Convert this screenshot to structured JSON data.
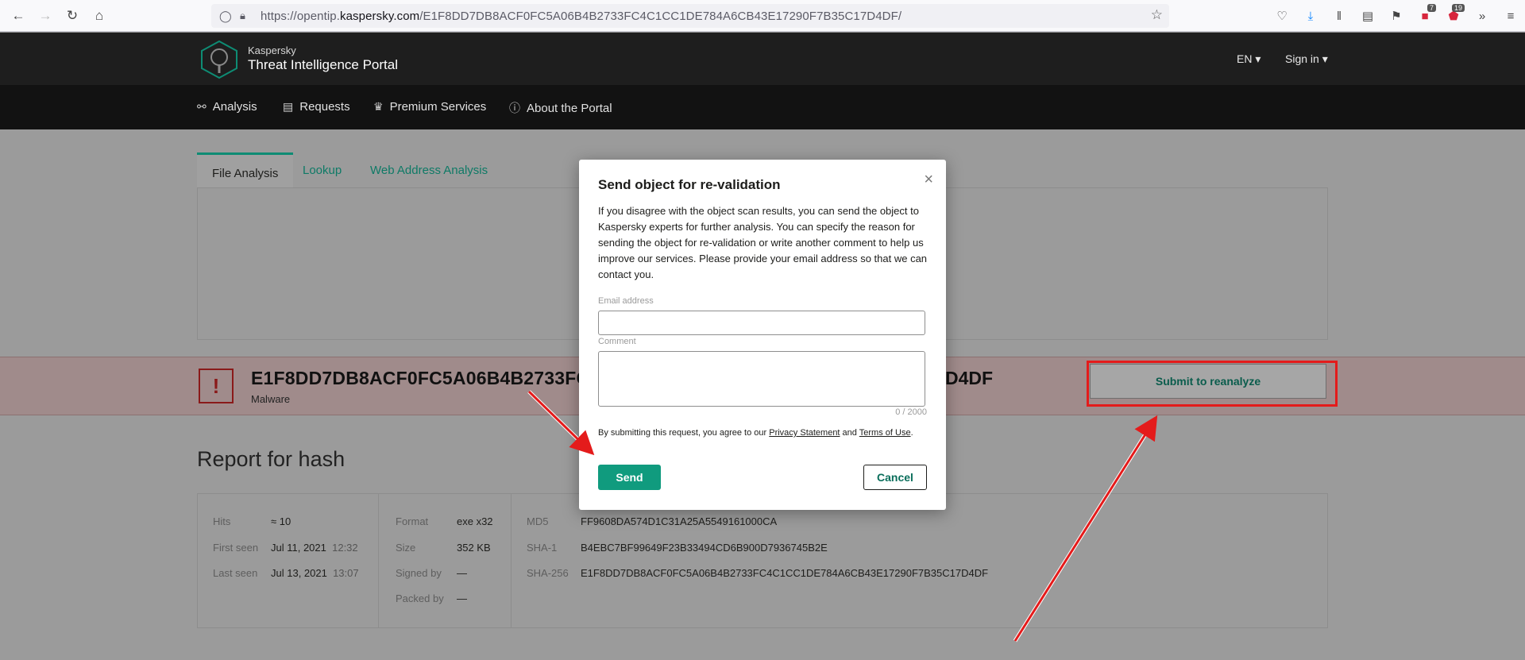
{
  "browser": {
    "url_prefix": "https://opentip.",
    "url_domain": "kaspersky.com",
    "url_path": "/E1F8DD7DB8ACF0FC5A06B4B2733FC4C1CC1DE784A6CB43E17290F7B35C17D4DF/",
    "badge_1": "7",
    "badge_2": "19"
  },
  "site": {
    "brand_small": "Kaspersky",
    "brand_big": "Threat Intelligence Portal",
    "lang": "EN ▾",
    "signin": "Sign in ▾",
    "nav": [
      "Analysis",
      "Requests",
      "Premium Services",
      "About the Portal"
    ]
  },
  "tabs": [
    "File Analysis",
    "Lookup",
    "Web Address Analysis"
  ],
  "alert": {
    "hash_visible": "E1F8DD7DB8ACF0FC5A06B4B2733FC",
    "hash_tail": "D4DF",
    "verdict": "Malware",
    "reanalyze_label": "Submit to reanalyze"
  },
  "report": {
    "title": "Report for hash",
    "hits_label": "Hits",
    "hits_value": "≈ 10",
    "first_seen_label": "First seen",
    "first_seen_date": "Jul 11, 2021",
    "first_seen_time": "12:32",
    "last_seen_label": "Last seen",
    "last_seen_date": "Jul 13, 2021",
    "last_seen_time": "13:07",
    "format_label": "Format",
    "format_value": "exe x32",
    "size_label": "Size",
    "size_value": "352 KB",
    "signed_label": "Signed by",
    "signed_value": "—",
    "packed_label": "Packed by",
    "packed_value": "—",
    "md5_label": "MD5",
    "md5_value": "FF9608DA574D1C31A25A5549161000CA",
    "sha1_label": "SHA-1",
    "sha1_value": "B4EBC7BF99649F23B33494CD6B900D7936745B2E",
    "sha256_label": "SHA-256",
    "sha256_value": "E1F8DD7DB8ACF0FC5A06B4B2733FC4C1CC1DE784A6CB43E17290F7B35C17D4DF"
  },
  "modal": {
    "title": "Send object for re-validation",
    "close": "×",
    "body": "If you disagree with the object scan results, you can send the object to Kaspersky experts for further analysis. You can specify the reason for sending the object for re-validation or write another comment to help us improve our services. Please provide your email address so that we can contact you.",
    "email_label": "Email address",
    "email_value": "",
    "comment_label": "Comment",
    "comment_value": "",
    "counter": "0 / 2000",
    "legal_pre": "By submitting this request, you agree to our ",
    "privacy": "Privacy Statement",
    "legal_and": " and ",
    "terms": "Terms of Use",
    "legal_end": ".",
    "send": "Send",
    "cancel": "Cancel"
  },
  "colors": {
    "accent": "#109b7e",
    "alert_red": "#e41b1b",
    "overlay": "#9b9b9b"
  }
}
